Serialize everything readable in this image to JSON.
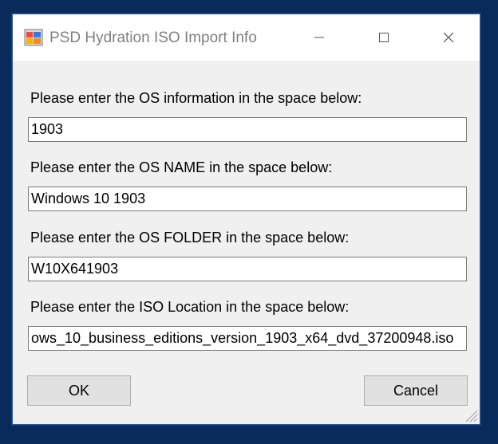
{
  "window": {
    "title": "PSD Hydration ISO Import Info",
    "icon": "app-window-icon"
  },
  "caption": {
    "minimize_icon": "minimize-icon",
    "maximize_icon": "maximize-icon",
    "close_icon": "close-icon"
  },
  "form": {
    "os_info": {
      "label": "Please enter the OS information in the space below:",
      "value": "1903"
    },
    "os_name": {
      "label": "Please enter the OS NAME in the space below:",
      "value": "Windows 10 1903"
    },
    "os_folder": {
      "label": "Please enter the OS FOLDER in the space below:",
      "value": "W10X641903"
    },
    "iso_location": {
      "label": "Please enter the ISO Location in the space below:",
      "value": "ows_10_business_editions_version_1903_x64_dvd_37200948.iso"
    }
  },
  "buttons": {
    "ok_label": "OK",
    "cancel_label": "Cancel"
  },
  "colors": {
    "desktop": "#0b2a5c",
    "window_bg": "#f0f0f0",
    "title_text": "#808080",
    "button_bg": "#e1e1e1"
  }
}
